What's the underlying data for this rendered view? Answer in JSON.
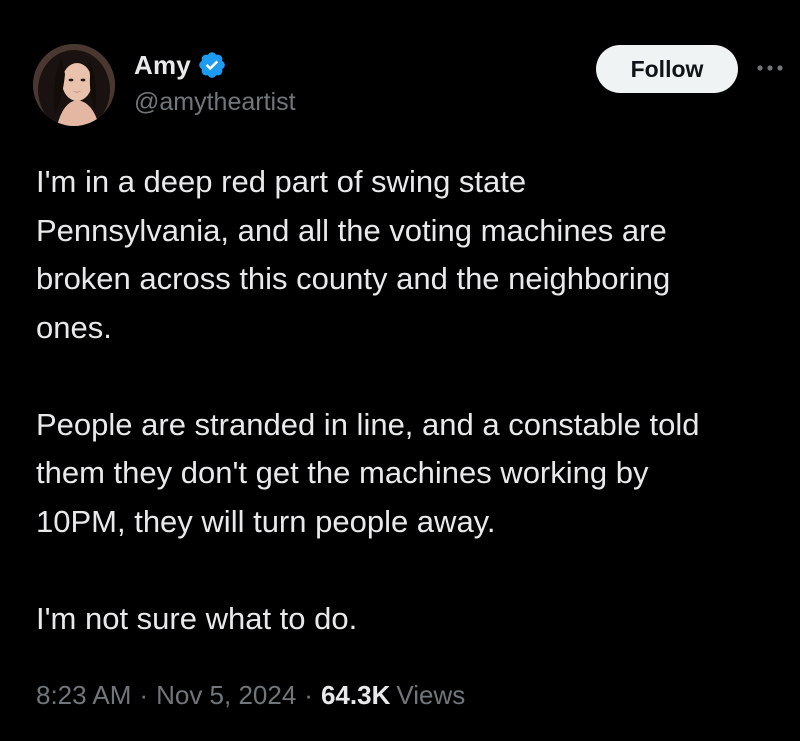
{
  "author": {
    "display_name": "Amy",
    "handle": "@amytheartist",
    "verified_icon": "verified-badge-icon",
    "avatar_icon": "profile-photo"
  },
  "actions": {
    "follow_label": "Follow",
    "more_icon": "more-options-icon"
  },
  "tweet": {
    "paragraphs": [
      "I'm in a deep red part of swing state\nPennsylvania, and all the voting machines are\nbroken across this county and the neighboring\nones.",
      "People are stranded in line, and a constable told\nthem they don't get the machines working by\n10PM, they will turn people away.",
      "I'm not sure what to do."
    ]
  },
  "meta": {
    "time": "8:23 AM",
    "separator": "·",
    "date": "Nov 5, 2024",
    "views_count": "64.3K",
    "views_label": "Views"
  },
  "colors": {
    "background": "#000000",
    "text_primary": "#e7e9ea",
    "text_secondary": "#71767b",
    "verified_blue": "#1d9bf0",
    "follow_bg": "#eff3f4"
  }
}
